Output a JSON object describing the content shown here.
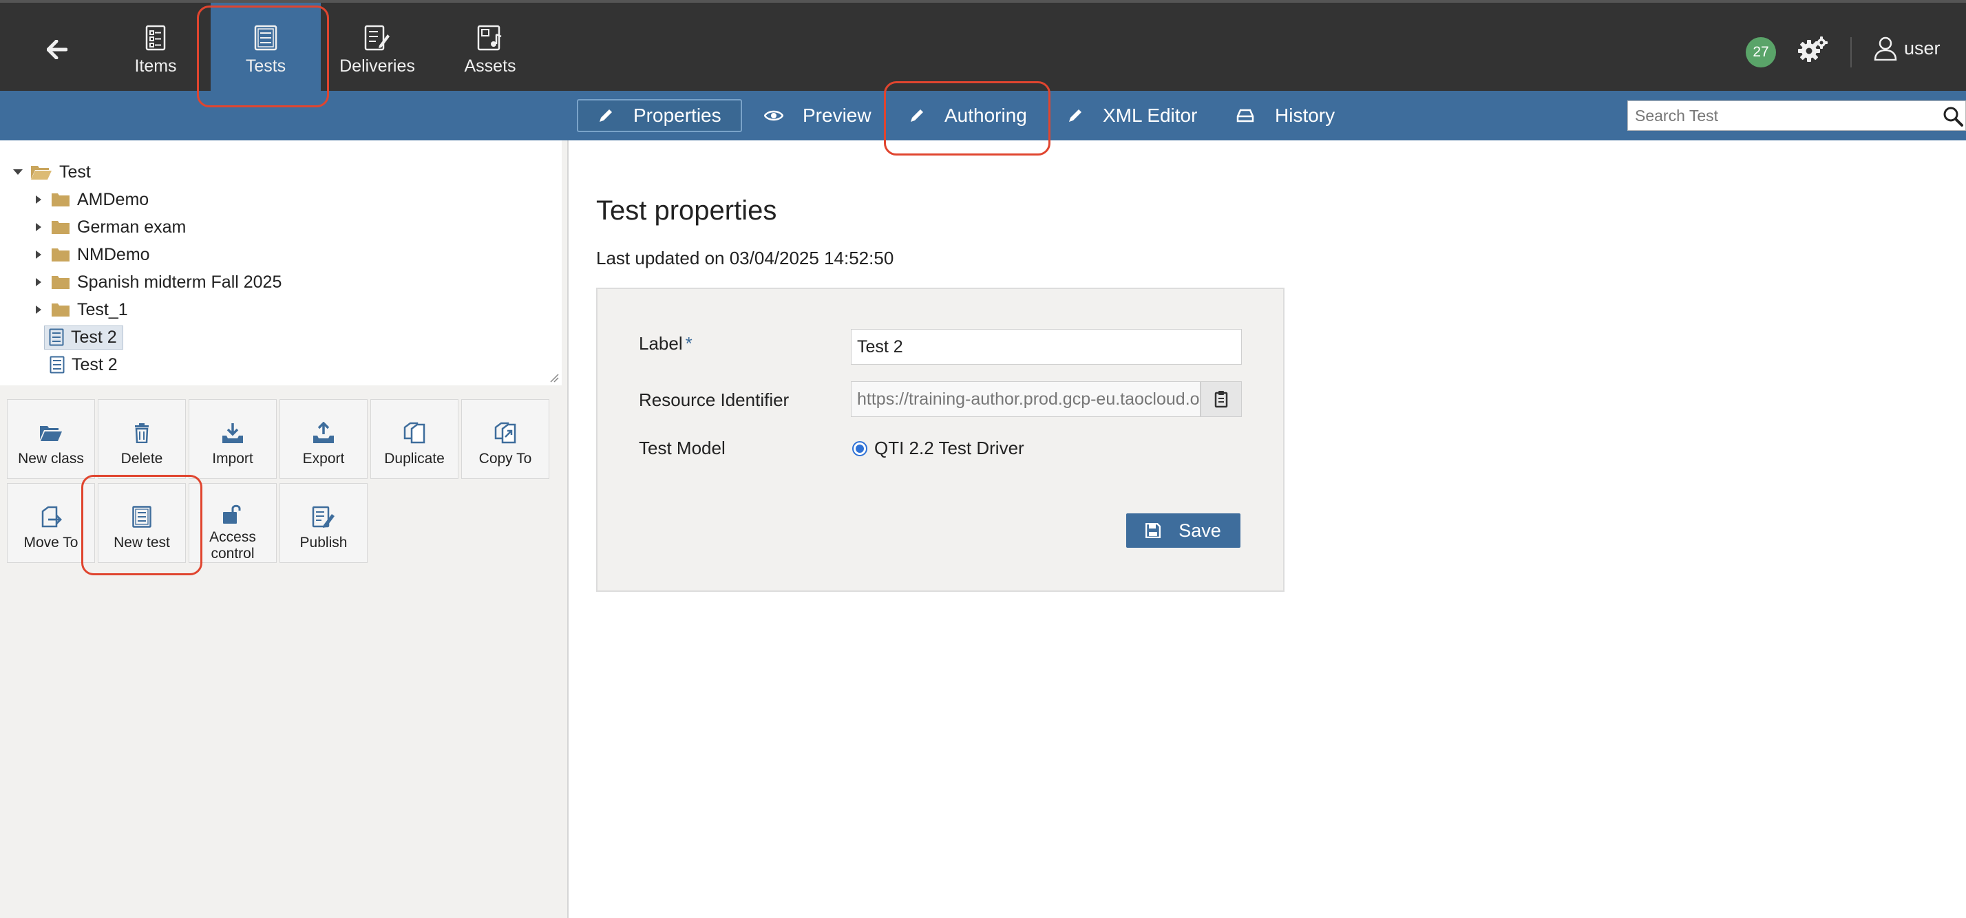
{
  "topnav": {
    "back_icon": "arrow-left-icon",
    "tabs": [
      {
        "label": "Items",
        "icon": "items-icon"
      },
      {
        "label": "Tests",
        "icon": "tests-icon",
        "active": true
      },
      {
        "label": "Deliveries",
        "icon": "deliveries-icon"
      },
      {
        "label": "Assets",
        "icon": "assets-icon"
      }
    ],
    "notification_count": "27",
    "user_label": "user"
  },
  "actionbar": {
    "tabs": [
      {
        "label": "Properties",
        "icon": "pencil-icon",
        "active": true
      },
      {
        "label": "Preview",
        "icon": "eye-icon"
      },
      {
        "label": "Authoring",
        "icon": "pencil-icon"
      },
      {
        "label": "XML Editor",
        "icon": "pencil-icon"
      },
      {
        "label": "History",
        "icon": "history-icon"
      }
    ],
    "search_placeholder": "Search Test"
  },
  "tree": {
    "root": "Test",
    "children": [
      {
        "label": "AMDemo",
        "type": "folder"
      },
      {
        "label": "German exam",
        "type": "folder"
      },
      {
        "label": "NMDemo",
        "type": "folder"
      },
      {
        "label": "Spanish midterm Fall 2025",
        "type": "folder"
      },
      {
        "label": "Test_1",
        "type": "folder"
      },
      {
        "label": "Test 2",
        "type": "test",
        "selected": true
      },
      {
        "label": "Test 2",
        "type": "test"
      }
    ]
  },
  "tools": [
    {
      "label": "New class",
      "icon": "folder-open-icon"
    },
    {
      "label": "Delete",
      "icon": "trash-icon"
    },
    {
      "label": "Import",
      "icon": "import-icon"
    },
    {
      "label": "Export",
      "icon": "export-icon"
    },
    {
      "label": "Duplicate",
      "icon": "duplicate-icon"
    },
    {
      "label": "Copy To",
      "icon": "copy-to-icon"
    },
    {
      "label": "Move To",
      "icon": "move-to-icon"
    },
    {
      "label": "New test",
      "icon": "new-test-icon"
    },
    {
      "label": "Access control",
      "icon": "unlock-icon"
    },
    {
      "label": "Publish",
      "icon": "publish-icon"
    }
  ],
  "main": {
    "title": "Test properties",
    "last_updated": "Last updated on 03/04/2025 14:52:50",
    "form": {
      "label_label": "Label",
      "required_mark": "*",
      "label_value": "Test 2",
      "resource_identifier_label": "Resource Identifier",
      "resource_identifier_value": "https://training-author.prod.gcp-eu.taocloud.org",
      "test_model_label": "Test Model",
      "test_model_option": "QTI 2.2 Test Driver",
      "save_label": "Save"
    }
  },
  "colors": {
    "topbar": "#333333",
    "accent": "#3e6d9c",
    "badge": "#5aa469",
    "highlight": "#e0452f"
  }
}
